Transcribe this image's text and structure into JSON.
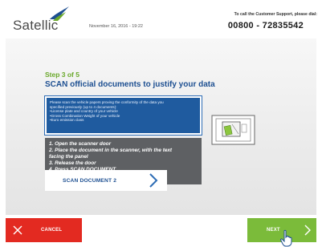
{
  "header": {
    "logo_text": "Satellic",
    "datetime": "November 16, 2016 - 19:22",
    "support_line": "To call the Customer Support, please dial:",
    "support_number": "00800 - 72835542"
  },
  "main": {
    "step_label": "Step 3 of 5",
    "step_title": "SCAN official documents to justify your data",
    "info_lines": [
      "Please scan the vehicle papers proving the conformity of the data you",
      "specified previously (up to 4 documents):",
      "•License plate and country of your vehicle",
      "•Gross Combination Weight of your vehicle",
      "•Euro emission class"
    ],
    "instructions": [
      "1. Open the scanner door",
      "2. Place the document in the scanner, with the text",
      "    facing the panel",
      "3. Release the door",
      "4. Press SCAN DOCUMENT"
    ],
    "scan_button_label": "SCAN DOCUMENT 2"
  },
  "footer": {
    "cancel_label": "CANCEL",
    "next_label": "NEXT"
  },
  "colors": {
    "brand_blue": "#1d4f91",
    "step_green": "#6aa82a",
    "cancel_red": "#e32a21",
    "next_green": "#7bbb3a",
    "steps_grey": "#5e6063"
  },
  "icons": {
    "logo": "satellic-bird-logo",
    "scan": "chevron-right-icon",
    "cancel": "close-icon",
    "next": "chevron-right-icon",
    "cursor": "hand-pointer-icon",
    "illustration": "scanner-illustration"
  }
}
